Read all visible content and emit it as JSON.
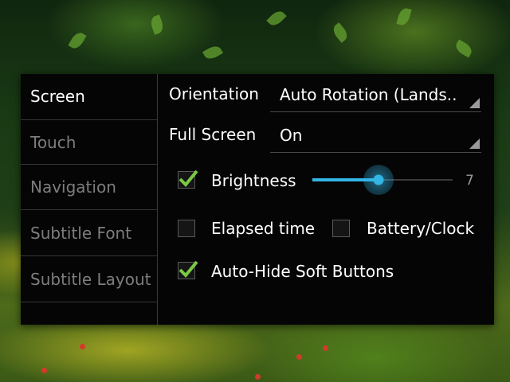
{
  "sidebar": {
    "tabs": [
      {
        "label": "Screen",
        "active": true
      },
      {
        "label": "Touch",
        "active": false
      },
      {
        "label": "Navigation",
        "active": false
      },
      {
        "label": "Subtitle Font",
        "active": false
      },
      {
        "label": "Subtitle Layout",
        "active": false
      }
    ]
  },
  "screen": {
    "orientation": {
      "label": "Orientation",
      "value": "Auto Rotation (Lands.."
    },
    "fullscreen": {
      "label": "Full Screen",
      "value": "On"
    },
    "brightness": {
      "label": "Brightness",
      "checked": true,
      "level": 7,
      "level_display": "7",
      "fill_fraction": 0.47
    },
    "elapsed_time": {
      "label": "Elapsed time",
      "checked": false
    },
    "battery_clock": {
      "label": "Battery/Clock",
      "checked": false
    },
    "auto_hide": {
      "label": "Auto-Hide Soft Buttons",
      "checked": true
    }
  },
  "colors": {
    "accent": "#33b5e5",
    "check": "#7ac943",
    "dialog_bg": "#050505"
  },
  "icons": {
    "dropdown": "dropdown-corner-arrow",
    "check": "checkmark-icon"
  }
}
